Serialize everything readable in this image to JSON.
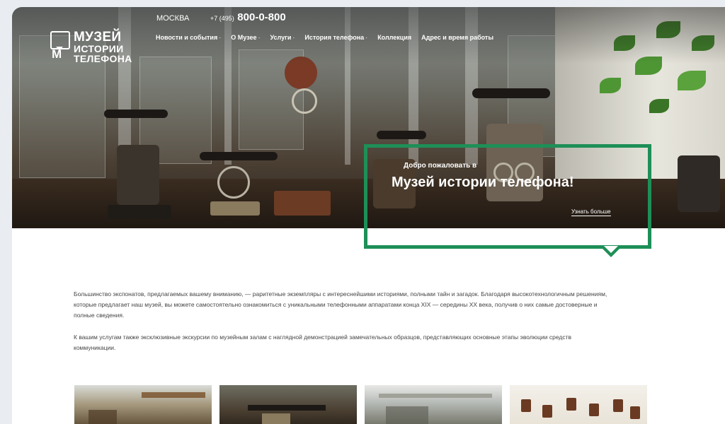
{
  "header": {
    "city": "МОСКВА",
    "phone_prefix": "+7 (495)",
    "phone_number": "800-0-800"
  },
  "logo": {
    "mark_letter": "М",
    "line1": "МУЗЕЙ",
    "line2": "ИСТОРИИ",
    "line3": "ТЕЛЕФОНА"
  },
  "nav": {
    "items": [
      {
        "label": "Новости и события",
        "dot": "·"
      },
      {
        "label": "О Музее",
        "dot": "·"
      },
      {
        "label": "Услуги",
        "dot": "·"
      },
      {
        "label": "История телефона",
        "dot": "·"
      },
      {
        "label": "Коллекция",
        "dot": ""
      },
      {
        "label": "Адрес и время работы",
        "dot": ""
      }
    ]
  },
  "welcome": {
    "subtitle": "Добро пожаловать в",
    "title": "Музей истории телефона!",
    "more_link": "Узнать больше"
  },
  "content": {
    "paragraph1": "Большинство экспонатов, предлагаемых вашему вниманию, — раритетные экземпляры с интереснейшими историями, полными тайн и загадок. Благодаря высокотехнологичным решениям, которые предлагает наш музей, вы можете самостоятельно ознакомиться с уникальными телефонными аппаратами конца XIX — середины XX века, получив о них самые достоверные и полные сведения.",
    "paragraph2": "К вашим услугам также эксклюзивные экскурсии по музейным залам с наглядной демонстрацией замечательных образцов, представляющих основные этапы эволюции средств коммуникации."
  },
  "colors": {
    "accent_green": "#1e8f57",
    "text": "#444444",
    "background": "#e9ecf1"
  }
}
